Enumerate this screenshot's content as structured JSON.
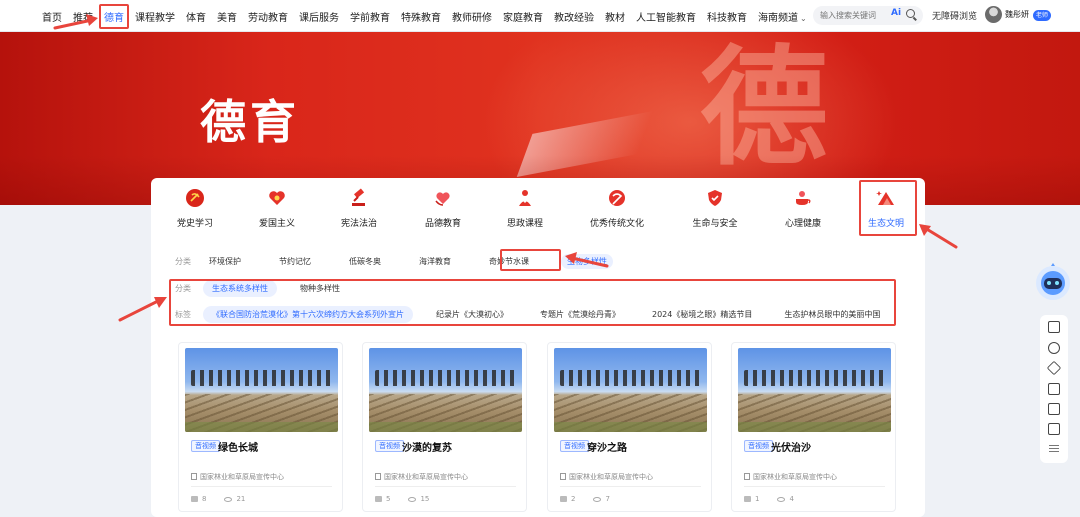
{
  "topnav": {
    "items": [
      {
        "label": "首页",
        "active": false
      },
      {
        "label": "推荐",
        "active": false
      },
      {
        "label": "德育",
        "active": true
      },
      {
        "label": "课程教学",
        "active": false
      },
      {
        "label": "体育",
        "active": false
      },
      {
        "label": "美育",
        "active": false
      },
      {
        "label": "劳动教育",
        "active": false
      },
      {
        "label": "课后服务",
        "active": false
      },
      {
        "label": "学前教育",
        "active": false
      },
      {
        "label": "特殊教育",
        "active": false
      },
      {
        "label": "教师研修",
        "active": false
      },
      {
        "label": "家庭教育",
        "active": false
      },
      {
        "label": "教改经验",
        "active": false
      },
      {
        "label": "教材",
        "active": false
      },
      {
        "label": "人工智能教育",
        "active": false
      },
      {
        "label": "科技教育",
        "active": false
      },
      {
        "label": "海南频道",
        "active": false
      }
    ],
    "search_placeholder": "输入搜索关键词",
    "ai_label": "Ai",
    "accessibility": "无障碍浏览",
    "username": "魏彤妍",
    "role_badge": "老师"
  },
  "banner": {
    "title": "德育",
    "big_char": "德",
    "color": "#d9261a"
  },
  "categories": [
    {
      "label": "党史学习",
      "icon": "party-emblem-icon"
    },
    {
      "label": "爱国主义",
      "icon": "heart-icon"
    },
    {
      "label": "宪法法治",
      "icon": "gavel-icon"
    },
    {
      "label": "品德教育",
      "icon": "heart-hands-icon"
    },
    {
      "label": "思政课程",
      "icon": "person-heart-icon"
    },
    {
      "label": "优秀传统文化",
      "icon": "seal-icon"
    },
    {
      "label": "生命与安全",
      "icon": "shield-icon"
    },
    {
      "label": "心理健康",
      "icon": "cup-icon"
    },
    {
      "label": "生态文明",
      "icon": "mountain-icon",
      "active": true
    }
  ],
  "subcategory": {
    "label": "分类",
    "items": [
      {
        "label": "环境保护",
        "active": false
      },
      {
        "label": "节约记忆",
        "active": false
      },
      {
        "label": "低碳冬奥",
        "active": false
      },
      {
        "label": "海洋教育",
        "active": false
      },
      {
        "label": "奇妙节水课",
        "active": false
      },
      {
        "label": "生物多样性",
        "active": true
      }
    ]
  },
  "classify": {
    "label": "分类",
    "items": [
      {
        "label": "生态系统多样性",
        "active": true
      },
      {
        "label": "物种多样性",
        "active": false
      }
    ]
  },
  "tags": {
    "label": "标签",
    "items": [
      {
        "label": "《联合国防治荒漠化》第十六次缔约方大会系列外宣片",
        "active": true
      },
      {
        "label": "纪录片《大漠初心》",
        "active": false
      },
      {
        "label": "专题片《荒漠绘丹青》",
        "active": false
      },
      {
        "label": "2024《秘境之眼》精选节目",
        "active": false
      },
      {
        "label": "生态护林员眼中的美丽中国",
        "active": false
      }
    ]
  },
  "videos": [
    {
      "type": "音视频",
      "title": "绿色长城",
      "source": "国家林业和草原局宣传中心",
      "likes": "8",
      "views": "21"
    },
    {
      "type": "音视频",
      "title": "沙漠的复苏",
      "source": "国家林业和草原局宣传中心",
      "likes": "5",
      "views": "15"
    },
    {
      "type": "音视频",
      "title": "穿沙之路",
      "source": "国家林业和草原局宣传中心",
      "likes": "2",
      "views": "7"
    },
    {
      "type": "音视频",
      "title": "光伏治沙",
      "source": "国家林业和草原局宣传中心",
      "likes": "1",
      "views": "4"
    }
  ],
  "rail": {
    "icons": [
      "home-icon",
      "help-icon",
      "cube-icon",
      "copy-icon",
      "document-icon",
      "feedback-icon",
      "more-icon"
    ]
  },
  "accent_color": "#2f6bff",
  "annotation_color": "#e8453c"
}
